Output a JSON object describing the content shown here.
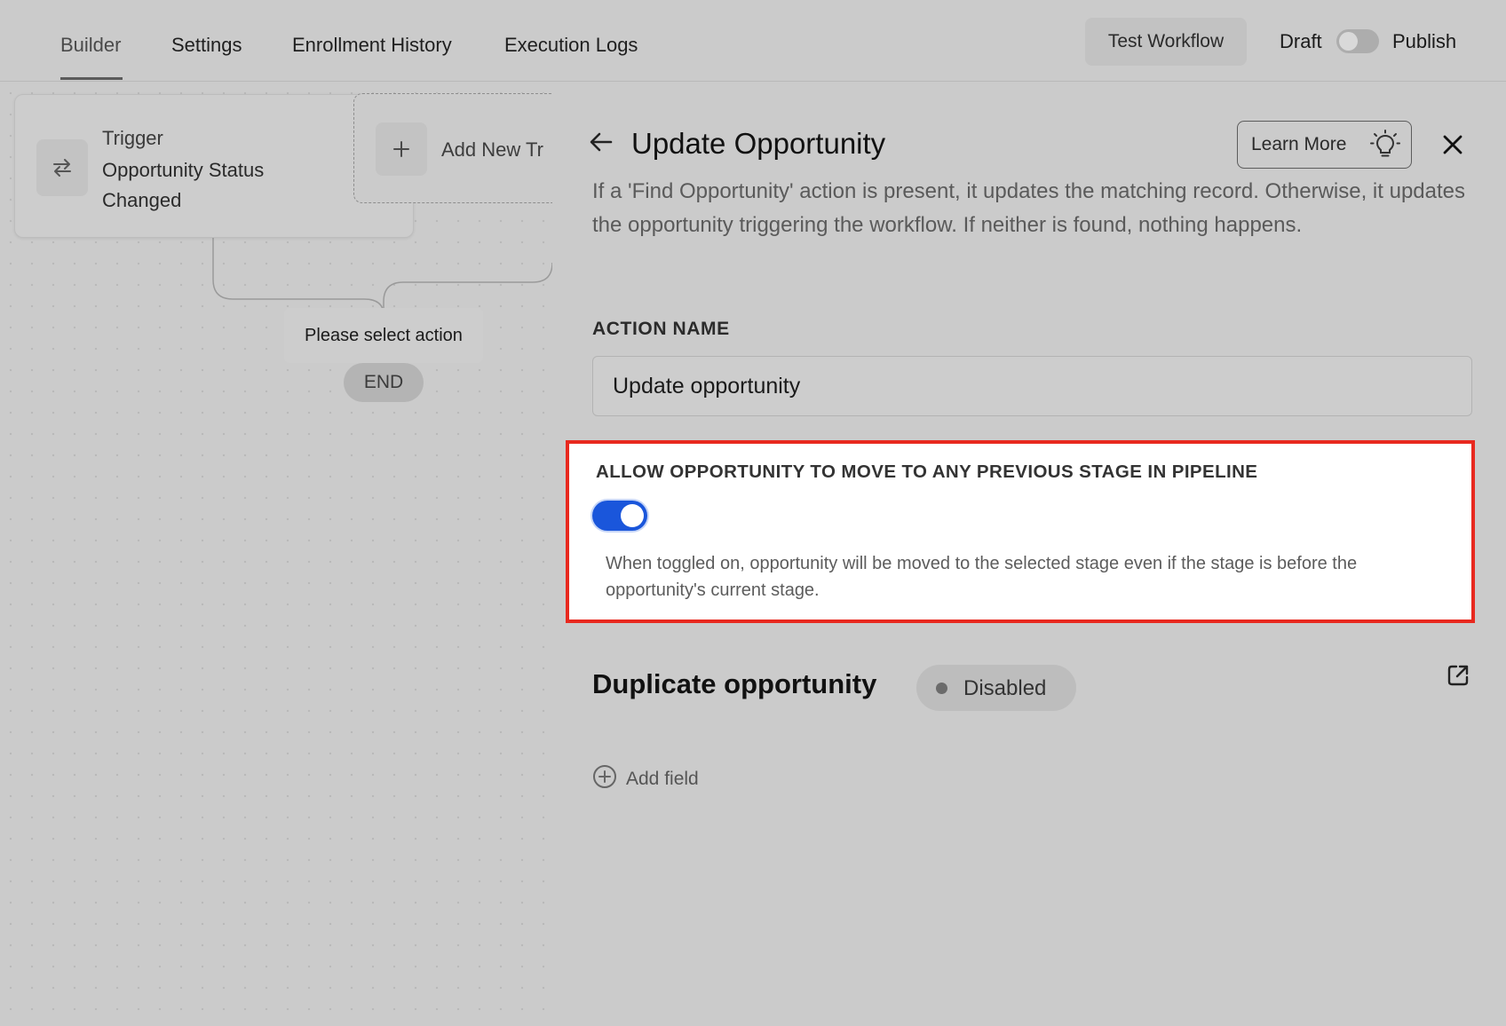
{
  "tabs": [
    {
      "label": "Builder",
      "active": true
    },
    {
      "label": "Settings",
      "active": false
    },
    {
      "label": "Enrollment History",
      "active": false
    },
    {
      "label": "Execution Logs",
      "active": false
    }
  ],
  "header": {
    "test_workflow": "Test Workflow",
    "draft_label": "Draft",
    "publish_label": "Publish",
    "publish_on": false
  },
  "canvas": {
    "trigger": {
      "title": "Trigger",
      "name": "Opportunity Status Changed",
      "icon": "swap-arrows-icon"
    },
    "add_trigger": {
      "label": "Add New Tr",
      "icon": "plus-icon"
    },
    "select_action": "Please select action",
    "end": "END"
  },
  "panel": {
    "title": "Update Opportunity",
    "learn_more": "Learn More",
    "description": "If a 'Find Opportunity' action is present, it updates the matching record. Otherwise, it updates the opportunity triggering the workflow. If neither is found, nothing happens.",
    "action_name": {
      "label": "ACTION NAME",
      "value": "Update opportunity"
    },
    "allow_previous_stage": {
      "label": "ALLOW OPPORTUNITY TO MOVE TO ANY PREVIOUS STAGE IN PIPELINE",
      "enabled": true,
      "help": "When toggled on, opportunity will be moved to the selected stage even if the stage is before the opportunity's current stage."
    },
    "duplicate": {
      "title": "Duplicate opportunity",
      "status": "Disabled"
    },
    "add_field": "Add field"
  },
  "colors": {
    "toggle_on": "#1a56db",
    "highlight_border": "#e8291f"
  }
}
